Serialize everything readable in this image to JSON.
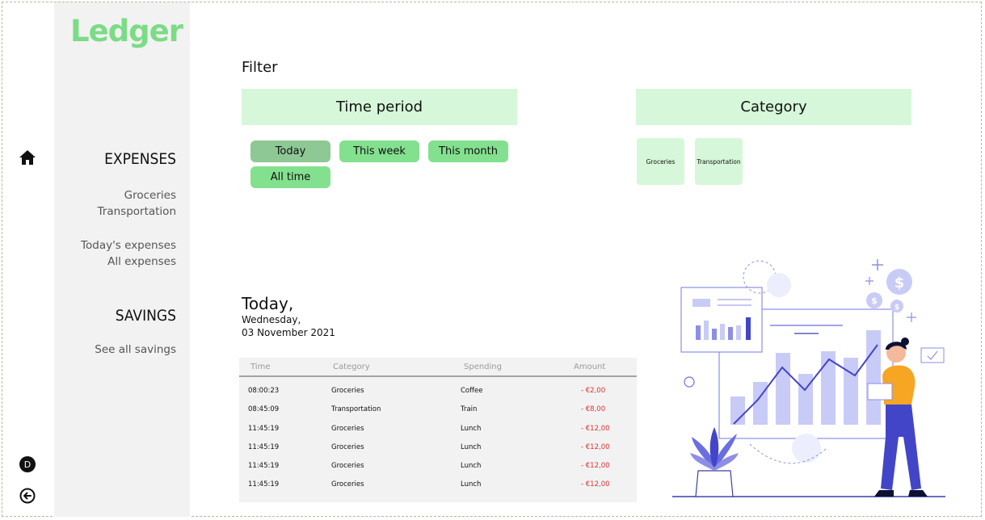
{
  "app": {
    "logo": "Ledger"
  },
  "sidebar": {
    "expenses_heading": "EXPENSES",
    "expenses_items": [
      "Groceries",
      "Transportation"
    ],
    "expenses_views": [
      "Today's expenses",
      "All expenses"
    ],
    "savings_heading": "SAVINGS",
    "savings_items": [
      "See all savings"
    ]
  },
  "rail": {
    "user_initial": "D"
  },
  "filter": {
    "title": "Filter",
    "time_period": {
      "heading": "Time period",
      "options": [
        "Today",
        "This week",
        "This month",
        "All time"
      ],
      "selected": "Today"
    },
    "category": {
      "heading": "Category",
      "options": [
        "Groceries",
        "Transportation"
      ]
    }
  },
  "today": {
    "title": "Today,",
    "weekday": "Wednesday,",
    "date": "03 November 2021"
  },
  "table": {
    "headers": [
      "Time",
      "Category",
      "Spending",
      "Amount"
    ],
    "rows": [
      [
        "08:00:23",
        "Groceries",
        "Coffee",
        "- €2,00"
      ],
      [
        "08:45:09",
        "Transportation",
        "Train",
        "- €8,00"
      ],
      [
        "11:45:19",
        "Groceries",
        "Lunch",
        "- €12,00"
      ],
      [
        "11:45:19",
        "Groceries",
        "Lunch",
        "- €12,00"
      ],
      [
        "11:45:19",
        "Groceries",
        "Lunch",
        "- €12,00"
      ],
      [
        "11:45:19",
        "Groceries",
        "Lunch",
        "- €12,00"
      ]
    ]
  },
  "colors": {
    "brand": "#7bdc86",
    "panel": "#d6f7d9",
    "pill": "#83e08e",
    "pill_active": "#8ec895",
    "negative_amount": "#e03030",
    "sidebar": "#f2f2f2"
  },
  "icons": [
    "home-icon",
    "user-d-icon",
    "logout-icon",
    "dashboard-illustration"
  ]
}
